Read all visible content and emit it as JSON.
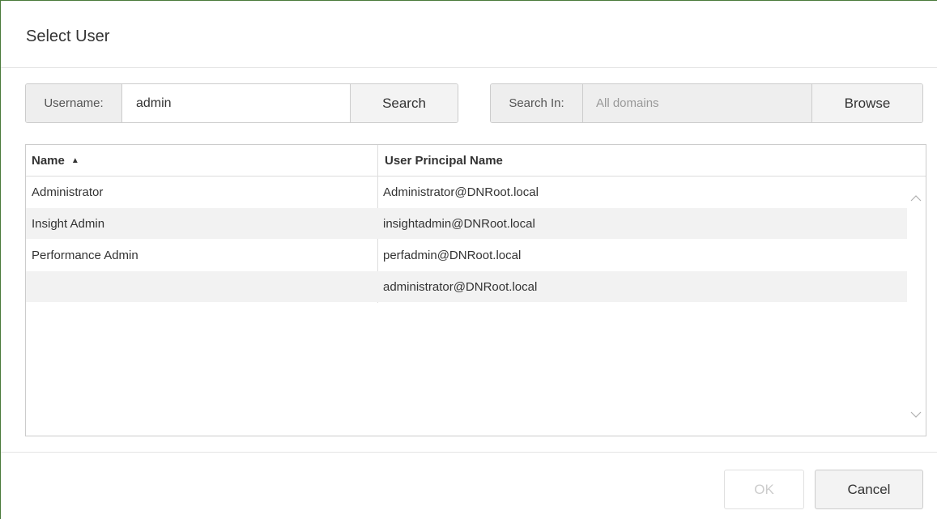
{
  "dialog": {
    "title": "Select User"
  },
  "search": {
    "username_label": "Username:",
    "username_value": "admin",
    "search_button": "Search",
    "search_in_label": "Search In:",
    "search_in_placeholder": "All domains",
    "browse_button": "Browse"
  },
  "grid": {
    "columns": [
      {
        "label": "Name",
        "sort": "ascending"
      },
      {
        "label": "User Principal Name"
      }
    ],
    "sort_indicator": "▲",
    "rows": [
      {
        "name": "Administrator",
        "upn": "Administrator@DNRoot.local"
      },
      {
        "name": "Insight Admin",
        "upn": "insightadmin@DNRoot.local"
      },
      {
        "name": "Performance Admin",
        "upn": "perfadmin@DNRoot.local"
      },
      {
        "name": "",
        "upn": "administrator@DNRoot.local"
      }
    ]
  },
  "footer": {
    "ok_button": "OK",
    "ok_enabled": false,
    "cancel_button": "Cancel"
  },
  "icons": {
    "scroll_up": "chevron-up-icon",
    "scroll_down": "chevron-down-icon"
  }
}
